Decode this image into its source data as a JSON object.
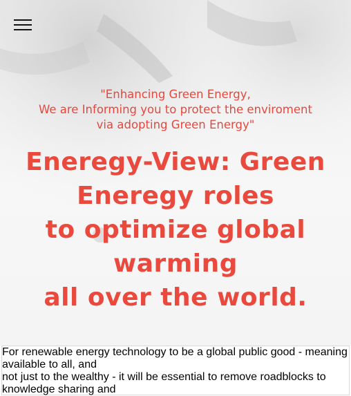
{
  "nav": {
    "menu_icon": "hamburger-menu-icon"
  },
  "hero": {
    "tagline_lines": [
      "\"Enhancing Green Energy,",
      "We are Informing you to protect the enviroment",
      "via adopting Green Energy\""
    ],
    "headline_lines": [
      "Eneregy-View: Green",
      "Eneregy roles",
      "to optimize global",
      "warming",
      "all over the world."
    ],
    "accent_color": "#ea4a3d"
  },
  "content": {
    "paragraph_lines": [
      "For renewable energy technology to be a global public good - meaning available to all, and",
      "not just to the wealthy - it will be essential to remove roadblocks to knowledge sharing and"
    ]
  }
}
